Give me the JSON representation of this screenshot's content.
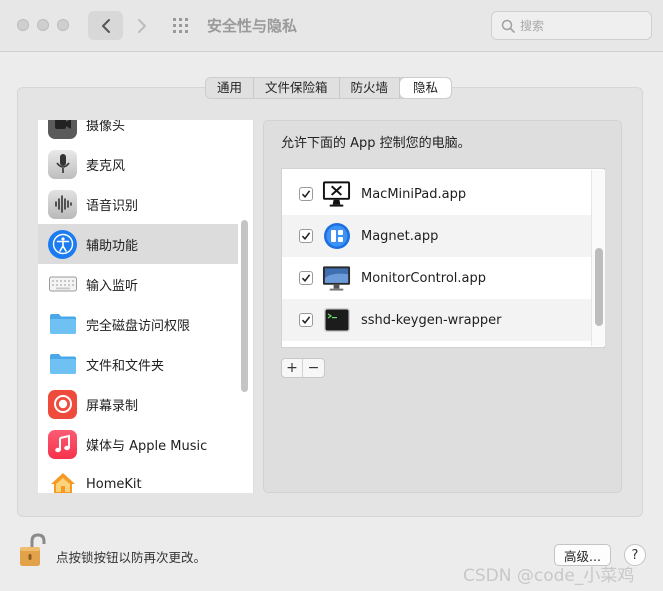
{
  "window": {
    "title": "安全性与隐私"
  },
  "toolbar": {
    "search_placeholder": "搜索"
  },
  "tabs": [
    {
      "label": "通用"
    },
    {
      "label": "文件保险箱"
    },
    {
      "label": "防火墙"
    },
    {
      "label": "隐私"
    }
  ],
  "sidebar": {
    "items": [
      {
        "label": "摄像头",
        "icon": "camera-icon"
      },
      {
        "label": "麦克风",
        "icon": "microphone-icon"
      },
      {
        "label": "语音识别",
        "icon": "waveform-icon"
      },
      {
        "label": "辅助功能",
        "icon": "accessibility-icon",
        "selected": true
      },
      {
        "label": "输入监听",
        "icon": "keyboard-icon"
      },
      {
        "label": "完全磁盘访问权限",
        "icon": "folder-icon"
      },
      {
        "label": "文件和文件夹",
        "icon": "folder-icon"
      },
      {
        "label": "屏幕录制",
        "icon": "record-icon"
      },
      {
        "label": "媒体与 Apple Music",
        "icon": "music-icon"
      },
      {
        "label": "HomeKit",
        "icon": "home-icon"
      }
    ]
  },
  "panel": {
    "title": "允许下面的 App 控制您的电脑。",
    "apps": [
      {
        "name": "MacMiniPad.app",
        "checked": true,
        "icon": "macminipad-app-icon"
      },
      {
        "name": "Magnet.app",
        "checked": true,
        "icon": "magnet-app-icon"
      },
      {
        "name": "MonitorControl.app",
        "checked": true,
        "icon": "monitorcontrol-app-icon"
      },
      {
        "name": "sshd-keygen-wrapper",
        "checked": true,
        "icon": "terminal-app-icon"
      }
    ],
    "add_label": "+",
    "remove_label": "−"
  },
  "footer": {
    "lock_text": "点按锁按钮以防再次更改。",
    "advanced_label": "高级...",
    "help_label": "?"
  },
  "watermark": "CSDN @code_小菜鸡",
  "colors": {
    "accent": "#1b7cf2",
    "selected_row": "#dcdcdc",
    "panel_bg": "#dedede"
  }
}
